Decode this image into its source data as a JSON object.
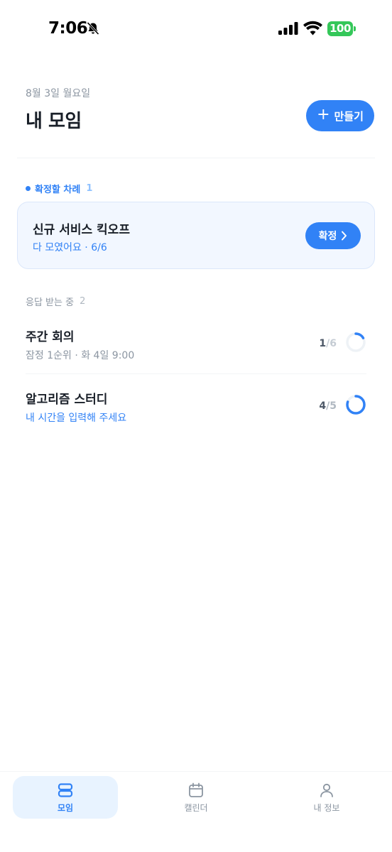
{
  "status_bar": {
    "time": "7:06",
    "battery": "100",
    "colors": {
      "battery": "#34c759"
    }
  },
  "header": {
    "date": "8월 3일 월요일",
    "title": "내 모임",
    "create_button": {
      "icon": "plus-icon",
      "label": "만들기"
    }
  },
  "confirm_section": {
    "label": "확정할 차례",
    "count": "1",
    "card": {
      "title": "신규 서비스 킥오프",
      "subtitle": "다 모였어요 · 6/6",
      "button_label": "확정",
      "button_icon": "chevron-right-icon"
    }
  },
  "responding_section": {
    "label": "응답 받는 중",
    "count": "2",
    "meetings": [
      {
        "title": "주간 회의",
        "subtitle": "잠정 1순위 · 화 4일 9:00",
        "responded": "1",
        "total": "/6",
        "progress": 0.167
      },
      {
        "title": "알고리즘 스터디",
        "subtitle": "내 시간을 입력해 주세요",
        "responded": "4",
        "total": "/5",
        "progress": 0.8
      }
    ]
  },
  "tab_bar": {
    "tabs": [
      {
        "label": "모임",
        "icon": "meetings-icon",
        "active": true
      },
      {
        "label": "캘린더",
        "icon": "calendar-icon",
        "active": false
      },
      {
        "label": "내 정보",
        "icon": "person-icon",
        "active": false
      }
    ]
  },
  "colors": {
    "accent": "#3182f6",
    "card_background": "#f2f7ff",
    "text_primary": "#191f28",
    "text_secondary": "#8b95a1"
  }
}
